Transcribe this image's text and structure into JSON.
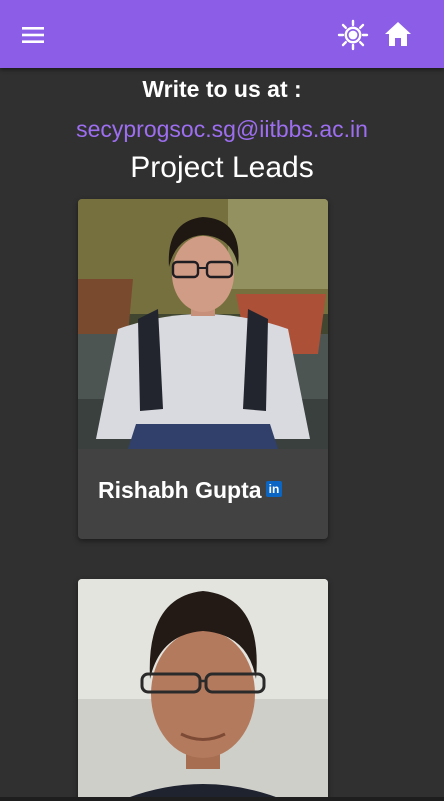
{
  "header": {
    "menu_icon": "menu-icon",
    "theme_icon": "brightness-sun-icon",
    "home_icon": "home-icon",
    "background_color": "#8c5ee8"
  },
  "contact": {
    "heading": "Write to us at :",
    "email": "secyprogsoc.sg@iitbbs.ac.in",
    "email_color": "#9d6ef0"
  },
  "project_leads": {
    "heading": "Project Leads",
    "leads": [
      {
        "name": "Rishabh Gupta",
        "social_icon": "linkedin-icon",
        "social_label": "in"
      },
      {
        "name": "",
        "social_icon": ""
      }
    ]
  },
  "colors": {
    "background": "#303030",
    "card": "#424242",
    "text": "#ffffff"
  }
}
